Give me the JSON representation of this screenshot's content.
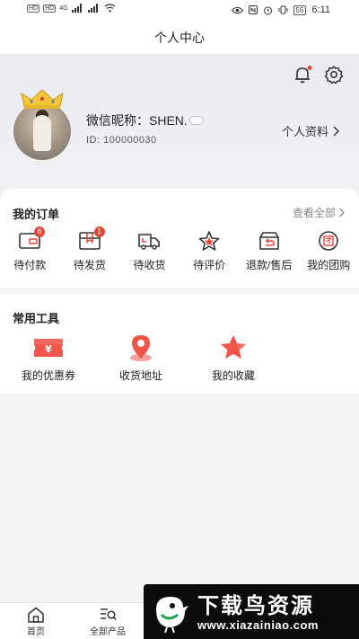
{
  "status_bar": {
    "time": "6:11",
    "battery": "55",
    "sim1": "HD",
    "sim2": "HD",
    "net": "4G"
  },
  "header": {
    "title": "个人中心"
  },
  "profile": {
    "nickname": "微信昵称：SHEN.",
    "user_id": "ID: 100000030",
    "profile_link": "个人资料",
    "notification_dot_color": "#e5463c"
  },
  "orders": {
    "title": "我的订单",
    "view_all": "查看全部",
    "items": [
      {
        "label": "待付款",
        "icon": "wallet-icon",
        "badge": "6"
      },
      {
        "label": "待发货",
        "icon": "package-icon",
        "badge": "1"
      },
      {
        "label": "待收货",
        "icon": "truck-icon",
        "badge": ""
      },
      {
        "label": "待评价",
        "icon": "star-review-icon",
        "badge": ""
      },
      {
        "label": "退款/售后",
        "icon": "refund-box-icon",
        "badge": ""
      },
      {
        "label": "我的团购",
        "icon": "group-buy-icon",
        "badge": ""
      }
    ]
  },
  "tools": {
    "title": "常用工具",
    "items": [
      {
        "label": "我的优惠券",
        "icon": "coupon-icon"
      },
      {
        "label": "收货地址",
        "icon": "location-pin-icon"
      },
      {
        "label": "我的收藏",
        "icon": "favorite-star-icon"
      }
    ]
  },
  "tabbar": {
    "items": [
      {
        "label": "首页",
        "icon": "home-icon"
      },
      {
        "label": "全部产品",
        "icon": "category-search-icon"
      }
    ]
  },
  "watermark": {
    "title": "下载鸟资源",
    "url": "www.xiazainiao.com"
  },
  "colors": {
    "accent": "#e5463c",
    "icon_stroke": "#333333",
    "tool_red": "#f2564a"
  }
}
